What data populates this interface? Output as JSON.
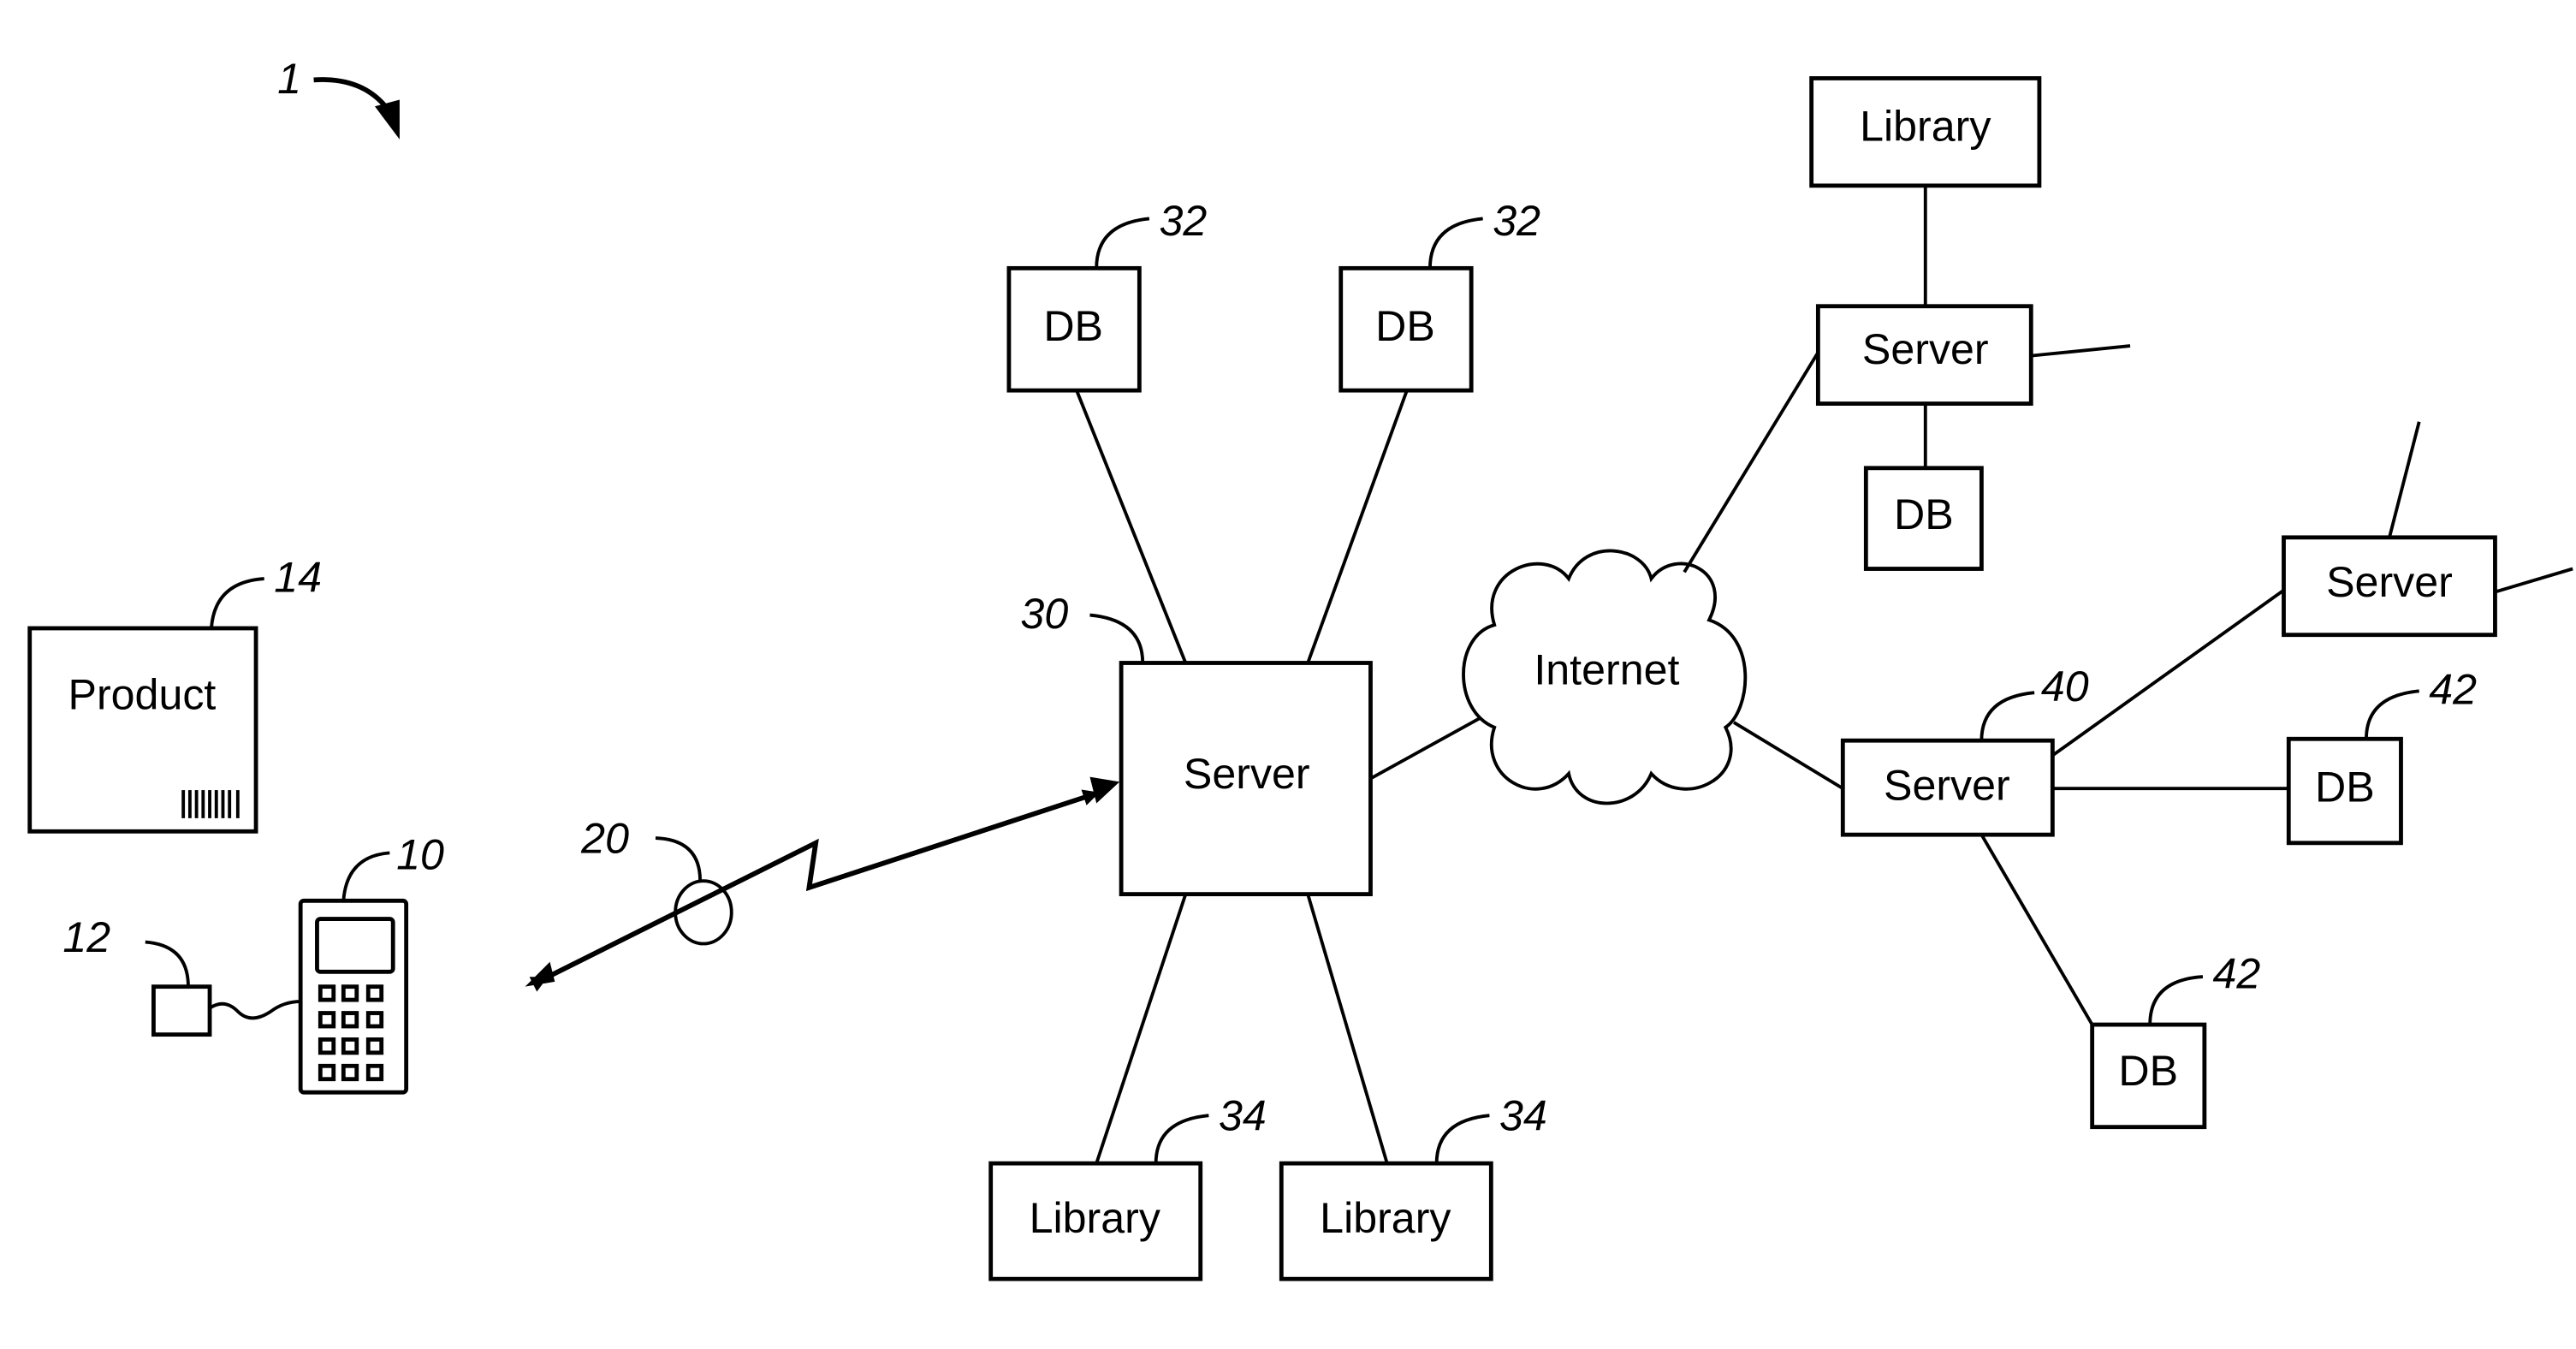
{
  "figure": {
    "reference": "1",
    "product": {
      "label": "Product",
      "ref": "14"
    },
    "device": {
      "ref": "10"
    },
    "scanner": {
      "ref": "12"
    },
    "wireless_link": {
      "ref": "20"
    },
    "main_server": {
      "label": "Server",
      "ref": "30"
    },
    "main_dbs": [
      {
        "label": "DB",
        "ref": "32"
      },
      {
        "label": "DB",
        "ref": "32"
      }
    ],
    "main_libraries": [
      {
        "label": "Library",
        "ref": "34"
      },
      {
        "label": "Library",
        "ref": "34"
      }
    ],
    "internet": {
      "label": "Internet"
    },
    "remote_top": {
      "library": {
        "label": "Library"
      },
      "server": {
        "label": "Server"
      },
      "db": {
        "label": "DB"
      }
    },
    "remote_server_right": {
      "label": "Server"
    },
    "remote_server_40": {
      "label": "Server",
      "ref": "40"
    },
    "remote_dbs_42": [
      {
        "label": "DB",
        "ref": "42"
      },
      {
        "label": "DB",
        "ref": "42"
      }
    ]
  }
}
